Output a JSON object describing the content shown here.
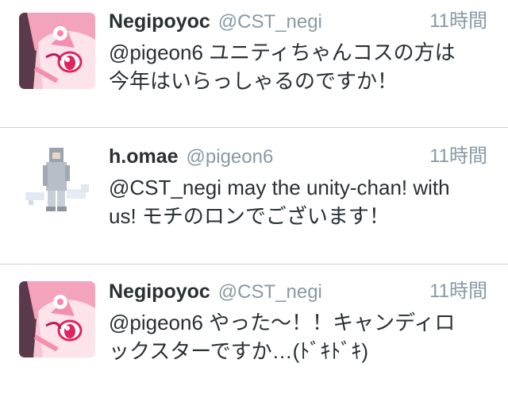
{
  "timeline": {
    "tweets": [
      {
        "name": "Negipoyoc",
        "handle": "@CST_negi",
        "time": "11時間",
        "text_line1": "@pigeon6 ユニティちゃんコスの方は",
        "text_line2": "今年はいらっしゃるのですか！",
        "avatar_icon": "anime-girl-avatar-icon"
      },
      {
        "name": "h.omae",
        "handle": "@pigeon6",
        "time": "11時間",
        "text_line1": "@CST_negi may the unity-chan! with",
        "text_line2": "us! モチのロンでございます！",
        "avatar_icon": "pixel-character-avatar-icon"
      },
      {
        "name": "Negipoyoc",
        "handle": "@CST_negi",
        "time": "11時間",
        "text_line1": "@pigeon6 やった〜！！キャンディロ",
        "text_line2": "ックスターですか…(ﾄﾞｷﾄﾞｷ)",
        "avatar_icon": "anime-girl-avatar-icon"
      }
    ]
  },
  "colors": {
    "name_text": "#292f33",
    "secondary_text": "#8899a6",
    "divider": "#cfd3d8",
    "avatar_hair": "#f4a3bd",
    "avatar_eye": "#e0245e"
  }
}
